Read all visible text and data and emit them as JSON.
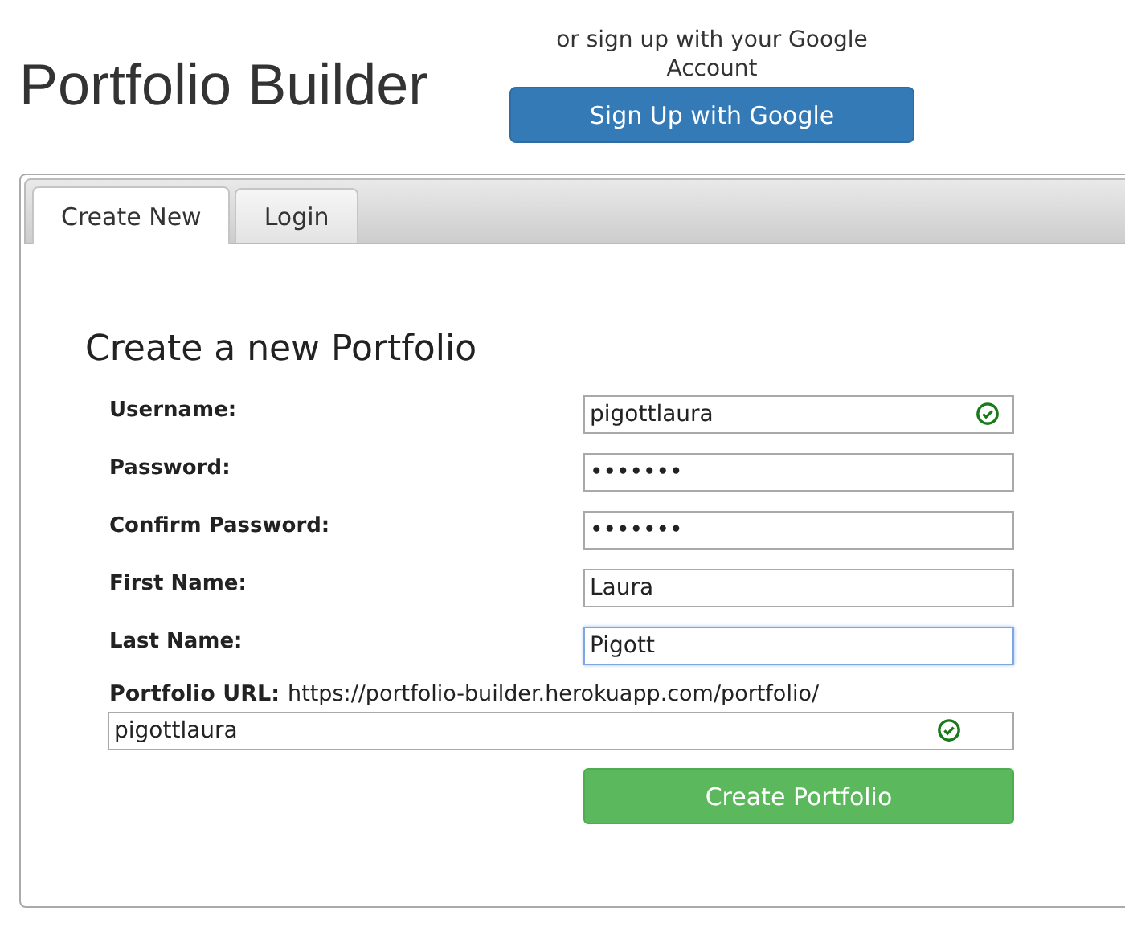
{
  "header": {
    "title": "Portfolio Builder",
    "google_prompt": "or sign up with your Google Account",
    "google_button": "Sign Up with Google"
  },
  "tabs": [
    {
      "label": "Create New",
      "selected": true
    },
    {
      "label": "Login",
      "selected": false
    }
  ],
  "form": {
    "heading": "Create a new Portfolio",
    "fields": [
      {
        "label": "Username:",
        "value": "pigottlaura",
        "valid": true,
        "focused": false
      },
      {
        "label": "Password:",
        "value": "•••••••",
        "valid": false,
        "focused": false
      },
      {
        "label": "Confirm Password:",
        "value": "•••••••",
        "valid": false,
        "focused": false
      },
      {
        "label": "First Name:",
        "value": "Laura",
        "valid": false,
        "focused": false
      },
      {
        "label": "Last Name:",
        "value": "Pigott",
        "valid": false,
        "focused": true
      }
    ],
    "url": {
      "label": "Portfolio URL:",
      "prefix": "https://portfolio-builder.herokuapp.com/portfolio/",
      "value": "pigottlaura",
      "valid": true
    },
    "submit": "Create Portfolio"
  }
}
